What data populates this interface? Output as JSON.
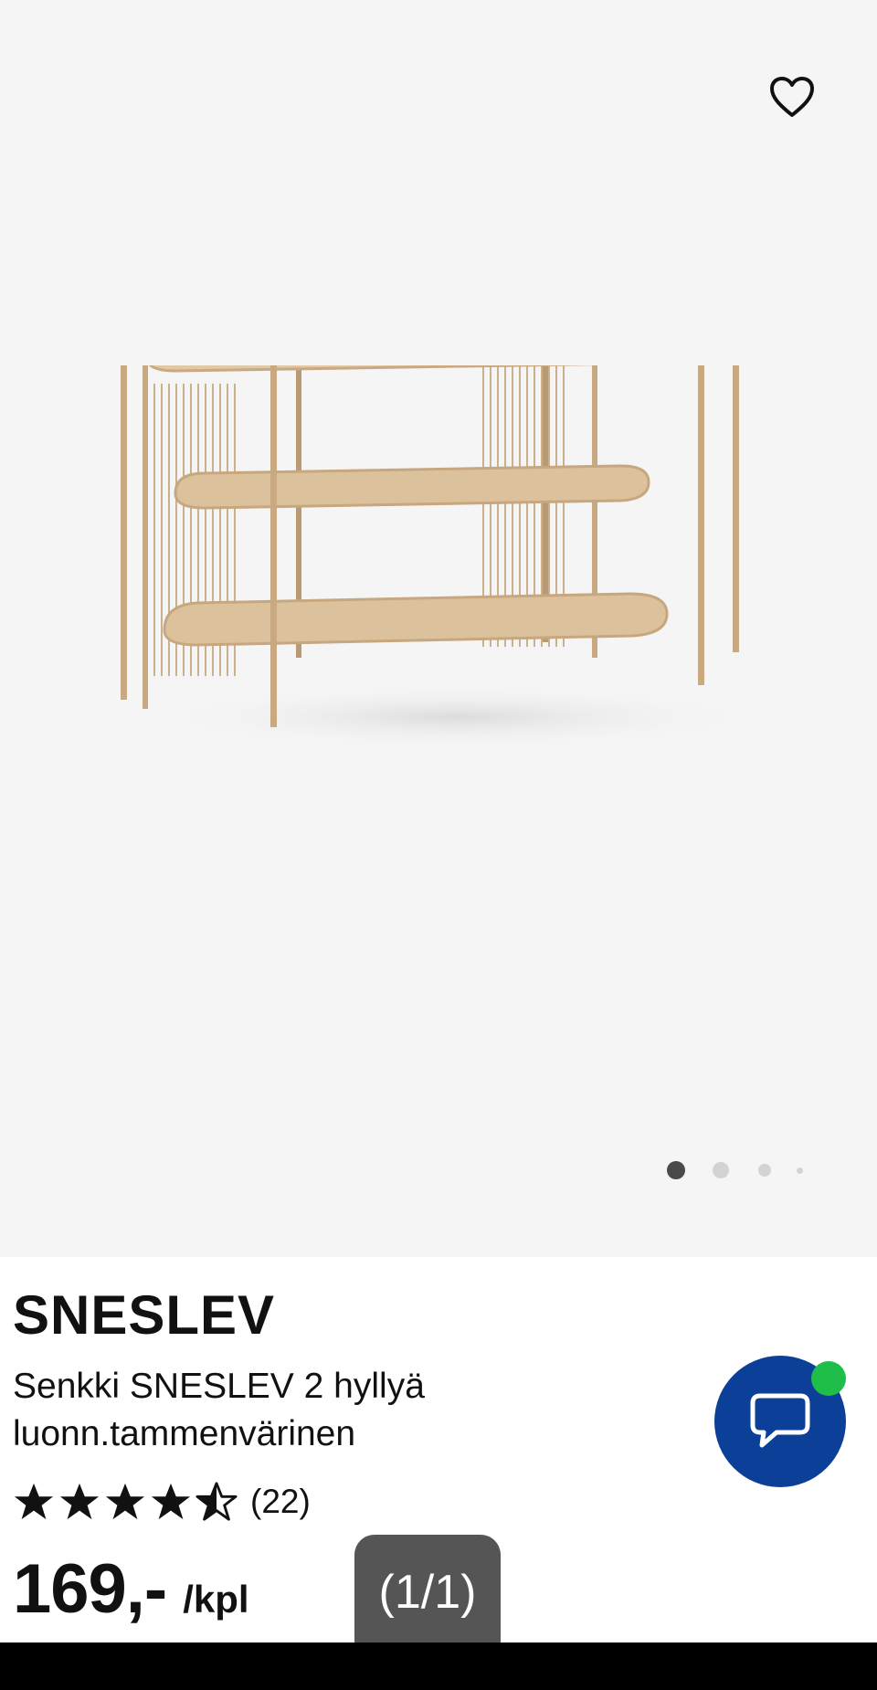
{
  "product": {
    "brand": "SNESLEV",
    "description_line1": "Senkki SNESLEV 2 hyllyä",
    "description_line2": "luonn.tammenvärinen",
    "rating": 4.5,
    "rating_max": 5,
    "review_count": "(22)",
    "price": "169,-",
    "price_unit": "/kpl"
  },
  "gallery": {
    "image_counter": "(1/1)",
    "image_count": 4,
    "active_index": 0
  },
  "icons": {
    "favorite": "heart-outline-icon",
    "chat": "chat-bubble-icon",
    "star_full": "star-filled-icon",
    "star_half": "star-half-icon"
  },
  "colors": {
    "hero_background": "#f5f5f5",
    "chat_button": "#0c3f97",
    "chat_status": "#1fbe4a",
    "wood": "#d8bd93",
    "frame": "#c9a982"
  }
}
